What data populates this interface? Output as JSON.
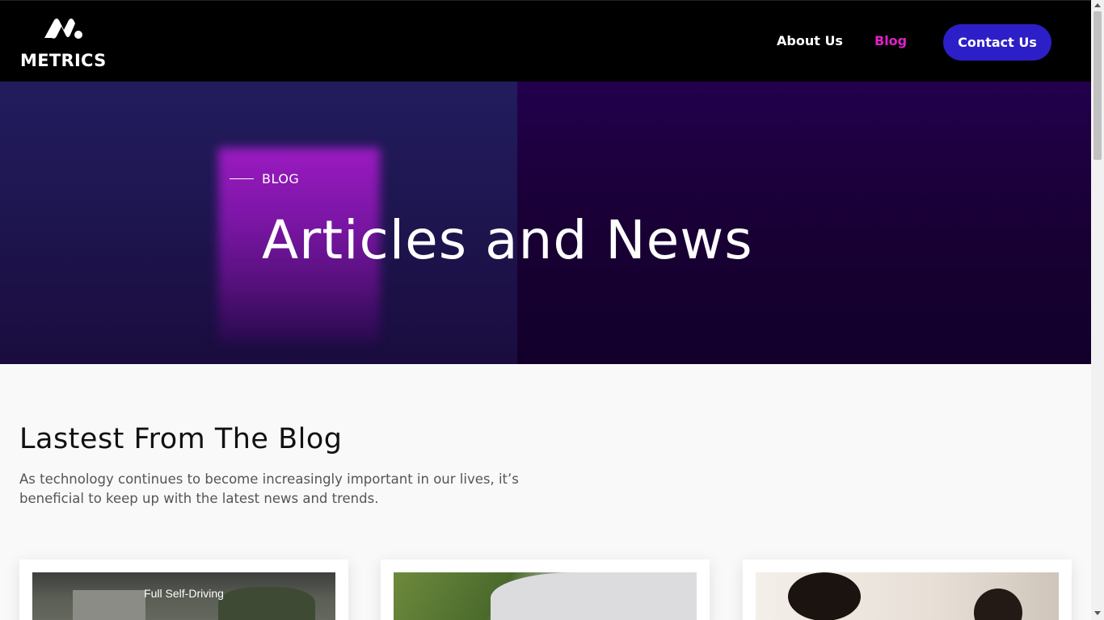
{
  "brand": {
    "name": "METRICS",
    "logo_icon": "metrics-logo-icon"
  },
  "nav": {
    "about_label": "About Us",
    "blog_label": "Blog",
    "contact_label": "Contact Us",
    "active": "Blog",
    "accent_color": "#e020c8",
    "button_color": "#2d1fc7"
  },
  "hero": {
    "eyebrow": "BLOG",
    "title": "Articles and News"
  },
  "section": {
    "title": "Lastest From The Blog",
    "description": "As technology continues to become increasingly important in our lives, it’s beneficial to keep up with the latest news and trends."
  },
  "cards": [
    {
      "image_caption": "Full Self-Driving"
    },
    {
      "image_caption": ""
    },
    {
      "image_caption": ""
    }
  ]
}
